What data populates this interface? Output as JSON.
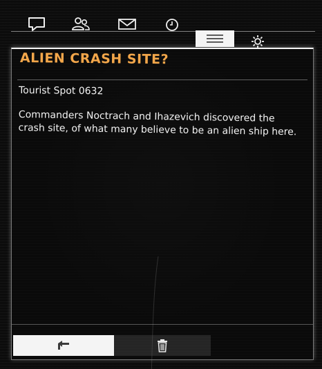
{
  "tabs": [
    {
      "icon": "chat-icon",
      "active": false
    },
    {
      "icon": "contacts-icon",
      "active": false
    },
    {
      "icon": "mail-icon",
      "active": false
    },
    {
      "icon": "clock-icon",
      "active": false
    },
    {
      "icon": "menu-list-icon",
      "active": true
    },
    {
      "icon": "settings-gear-icon",
      "active": false
    }
  ],
  "entry": {
    "title": "ALIEN CRASH SITE?",
    "system_name": "Tourist Spot 0632",
    "description": "Commanders Noctrach and Ihazevich discovered the crash site, of what many believe to be an alien ship here."
  },
  "actions": {
    "back_icon": "back-arrow-icon",
    "delete_icon": "trash-icon"
  },
  "colors": {
    "title": "#f2a64a",
    "text": "#f2f2f2",
    "active_tab_bg": "#f4f4f4",
    "background": "#0c0c0c"
  }
}
